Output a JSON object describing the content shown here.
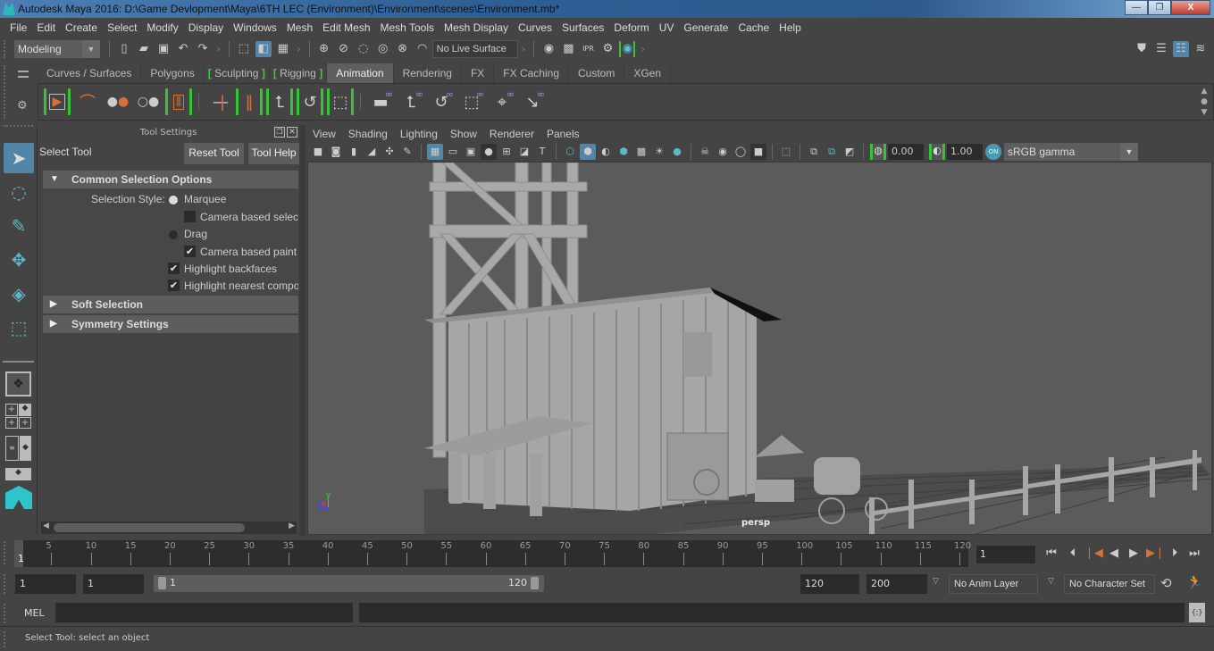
{
  "window": {
    "title": "Autodesk Maya 2016: D:\\Game Devlopment\\Maya\\6TH LEC (Environment)\\Environment\\scenes\\Environment.mb*",
    "minimize": "—",
    "restore": "❐",
    "close": "X"
  },
  "menubar": [
    "File",
    "Edit",
    "Create",
    "Select",
    "Modify",
    "Display",
    "Windows",
    "Mesh",
    "Edit Mesh",
    "Mesh Tools",
    "Mesh Display",
    "Curves",
    "Surfaces",
    "Deform",
    "UV",
    "Generate",
    "Cache",
    "Help"
  ],
  "statusline": {
    "menuset": "Modeling",
    "live_surface": "No Live Surface",
    "icons": [
      "new-scene-icon",
      "open-scene-icon",
      "save-scene-icon",
      "undo-icon",
      "redo-icon",
      "select-hierarchy-icon",
      "select-object-icon",
      "select-component-icon",
      "snap-grid-icon",
      "snap-curve-icon",
      "snap-point-icon",
      "snap-projected-center-icon",
      "snap-view-plane-icon",
      "make-live-icon",
      "render-view-icon",
      "render-current-frame-icon",
      "ipr-render-icon",
      "render-settings-icon",
      "hypershade-icon",
      "modeling-toolkit-icon",
      "channel-box-toggle-icon",
      "attribute-editor-toggle-icon",
      "layer-editor-toggle-icon"
    ]
  },
  "shelf": {
    "tabs": [
      "Curves / Surfaces",
      "Polygons",
      "Sculpting",
      "Rigging",
      "Animation",
      "Rendering",
      "FX",
      "FX Caching",
      "Custom",
      "XGen"
    ],
    "active_tab": "Animation",
    "icons": [
      "playblast-icon",
      "motion-trail-icon",
      "create-ghost-icon",
      "unghost-icon",
      "timeline-editor-icon",
      "set-key-icon",
      "set-breakdown-icon",
      "key-translate-icon",
      "key-rotate-icon",
      "key-scale-icon",
      "parent-constraint-icon",
      "point-constraint-icon",
      "orient-constraint-icon",
      "scale-constraint-icon",
      "aim-constraint-icon",
      "pole-vector-constraint-icon"
    ]
  },
  "toolbox": [
    "select-tool-icon",
    "lasso-tool-icon",
    "paint-select-tool-icon",
    "move-tool-icon",
    "rotate-tool-icon",
    "scale-tool-icon"
  ],
  "tool_settings": {
    "panel_title": "Tool Settings",
    "tool_name": "Select Tool",
    "reset_button": "Reset Tool",
    "help_button": "Tool Help",
    "sections": {
      "common": "Common Selection Options",
      "soft": "Soft Selection",
      "symmetry": "Symmetry Settings"
    },
    "selection_style_label": "Selection Style:",
    "marquee": "Marquee",
    "camera_based_selection": "Camera based selecti",
    "drag": "Drag",
    "camera_based_paint": "Camera based paint s",
    "highlight_backfaces": "Highlight backfaces",
    "highlight_nearest": "Highlight nearest compo",
    "selection_style_value": "Marquee",
    "camera_based_selection_checked": false,
    "camera_based_paint_checked": true,
    "highlight_backfaces_checked": true,
    "highlight_nearest_checked": true
  },
  "viewport": {
    "menus": [
      "View",
      "Shading",
      "Lighting",
      "Show",
      "Renderer",
      "Panels"
    ],
    "exposure": "0.00",
    "gamma": "1.00",
    "color_management": "ON",
    "color_space": "sRGB gamma",
    "camera_label": "persp",
    "axis": {
      "y": "y",
      "z": "z",
      "x": "x"
    }
  },
  "timeline": {
    "ticks": [
      "5",
      "10",
      "15",
      "20",
      "25",
      "30",
      "35",
      "40",
      "45",
      "50",
      "55",
      "60",
      "65",
      "70",
      "75",
      "80",
      "85",
      "90",
      "95",
      "100",
      "105",
      "110",
      "115",
      "120"
    ],
    "current_marker": "1",
    "current_frame": "1",
    "playback_buttons": [
      "go-to-start-icon",
      "step-back-frame-icon",
      "step-back-key-icon",
      "play-backwards-icon",
      "play-forwards-icon",
      "step-forward-key-icon",
      "step-forward-frame-icon",
      "go-to-end-icon"
    ]
  },
  "range": {
    "start_time": "1",
    "playback_start": "1",
    "slider_start": "1",
    "slider_end": "120",
    "playback_end": "120",
    "end_time": "200",
    "anim_layer": "No Anim Layer",
    "character_set": "No Character Set"
  },
  "command_line": {
    "language": "MEL",
    "input": "",
    "result": ""
  },
  "help_line": "Select Tool: select an object"
}
